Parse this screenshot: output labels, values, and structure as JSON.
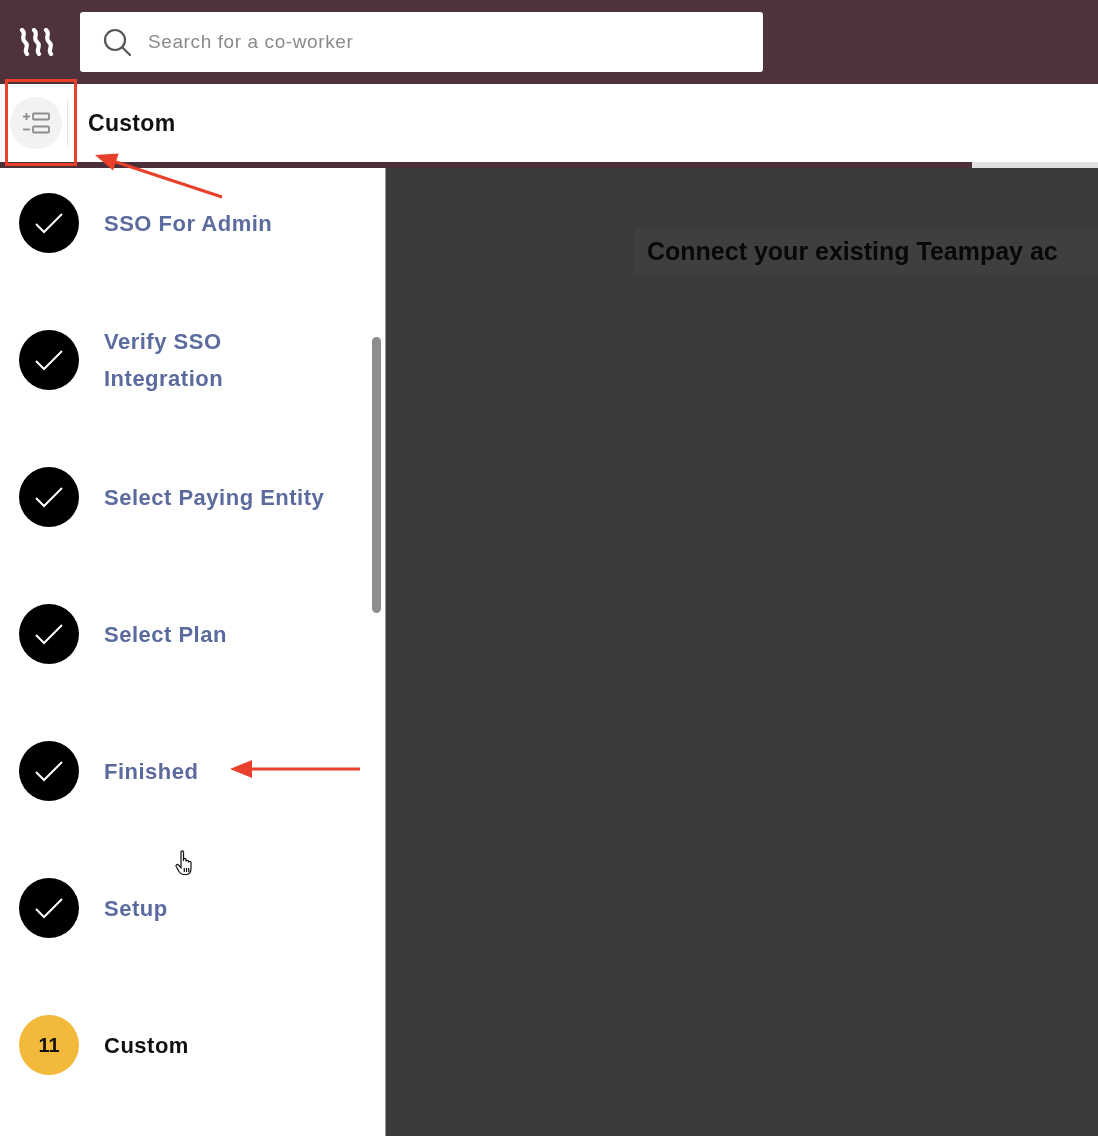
{
  "top_bar": {
    "search": {
      "placeholder": "Search for a co-worker"
    }
  },
  "header": {
    "title": "Custom"
  },
  "steps": [
    {
      "label": "SSO For Admin",
      "completed": true
    },
    {
      "label": "Verify SSO Integration",
      "completed": true
    },
    {
      "label": "Select Paying Entity",
      "completed": true
    },
    {
      "label": "Select Plan",
      "completed": true
    },
    {
      "label": "Finished",
      "completed": true
    },
    {
      "label": "Setup",
      "completed": true
    },
    {
      "label": "Custom",
      "completed": false,
      "number": "11"
    }
  ],
  "main": {
    "heading": "Connect your existing Teampay ac"
  }
}
